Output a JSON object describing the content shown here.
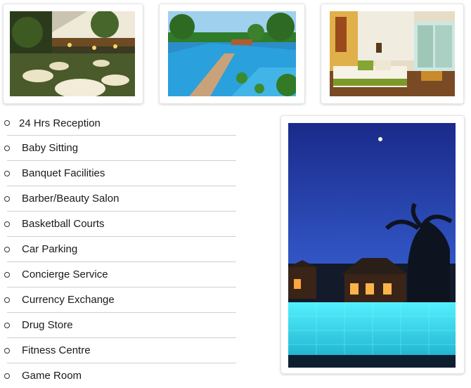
{
  "gallery": {
    "thumbnails": [
      {
        "name": "restaurant-terrace-photo"
      },
      {
        "name": "resort-pool-photo"
      },
      {
        "name": "guest-room-photo"
      }
    ],
    "feature_photo": {
      "name": "night-pool-villa-photo"
    }
  },
  "amenities": {
    "items": [
      {
        "label": "24 Hrs Reception"
      },
      {
        "label": "Baby Sitting"
      },
      {
        "label": "Banquet Facilities"
      },
      {
        "label": "Barber/Beauty Salon"
      },
      {
        "label": "Basketball Courts"
      },
      {
        "label": "Car Parking"
      },
      {
        "label": "Concierge Service"
      },
      {
        "label": "Currency Exchange"
      },
      {
        "label": "Drug Store"
      },
      {
        "label": "Fitness Centre"
      },
      {
        "label": "Game Room"
      }
    ]
  },
  "colors": {
    "divider": "#cfcfcf",
    "text": "#1a1a1a",
    "frame_border": "#e4e4e4"
  }
}
